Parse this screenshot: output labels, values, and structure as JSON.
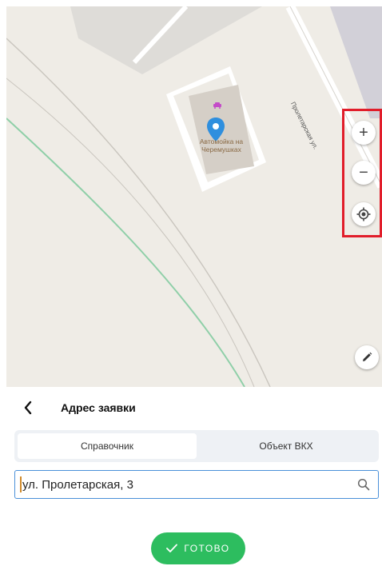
{
  "map": {
    "poi_name": "Автомойка на Черемушках",
    "street_label": "Пролетарская ул.",
    "controls": {
      "zoom_in": "+",
      "zoom_out": "−",
      "locate_icon": "locate-icon",
      "edit_icon": "pencil-icon"
    }
  },
  "header": {
    "back_icon": "chevron-left-icon",
    "title": "Адрес заявки"
  },
  "tabs": [
    {
      "label": "Справочник",
      "active": true
    },
    {
      "label": "Объект ВКХ",
      "active": false
    }
  ],
  "address_field": {
    "value": "ул. Пролетарская, 3",
    "icon": "search-icon"
  },
  "done_button": {
    "label": "ГОТОВО",
    "icon": "check-icon",
    "color": "#2dbd5f"
  },
  "colors": {
    "accent_highlight": "#e11d2a",
    "pin": "#2f8fde",
    "field_border": "#4a90d9"
  }
}
